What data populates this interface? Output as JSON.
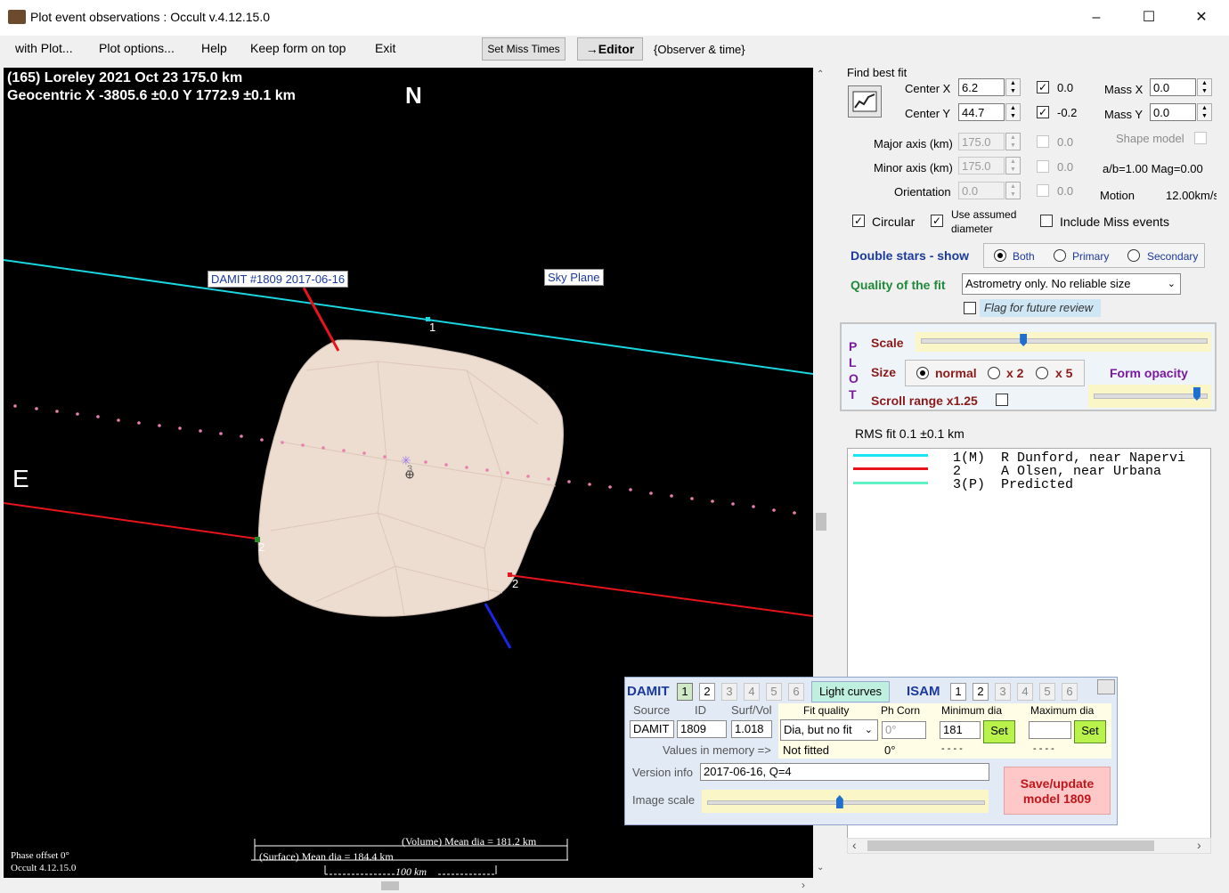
{
  "window": {
    "title": "Plot event observations : Occult v.4.12.15.0",
    "controls": [
      "–",
      "☐",
      "✕"
    ]
  },
  "menu": {
    "items": [
      "with Plot...",
      "Plot options...",
      "Help",
      "Keep form on top",
      "Exit"
    ],
    "set_miss_times": "Set Miss Times",
    "editor": "→Editor",
    "observer_time": "{Observer & time}"
  },
  "plot": {
    "header_line1": "(165) Loreley  2021 Oct 23   175.0 km",
    "header_line2": "Geocentric  X  -3805.6 ±0.0  Y 1772.9 ±0.1 km",
    "north": "N",
    "east": "E",
    "damit_label": "DAMIT #1809 2017-06-16",
    "sky_plane": "Sky Plane",
    "chord_label_1": "1",
    "chord_label_2a": "2",
    "chord_label_2b": "2",
    "center_mark": "3",
    "volume_dia": "(Volume) Mean dia = 181.2 km",
    "surface_dia": "(Surface) Mean dia = 184.4 km",
    "scale_100": "100 km",
    "phase_offset": "Phase offset 0°",
    "occult_version": "Occult 4.12.15.0",
    "colors": {
      "chord1": "#19d6e0",
      "chord2": "#e8141b",
      "body": "#eddcd0"
    }
  },
  "fit": {
    "find_best_fit": "Find best fit",
    "center_x_label": "Center X",
    "center_x": "6.2",
    "center_y_label": "Center Y",
    "center_y": "44.7",
    "cx_offset": "0.0",
    "cy_offset": "-0.2",
    "mass_x_label": "Mass X",
    "mass_x": "0.0",
    "mass_y_label": "Mass Y",
    "mass_y": "0.0",
    "major_label": "Major axis (km)",
    "major": "175.0",
    "major_off": "0.0",
    "minor_label": "Minor axis (km)",
    "minor": "175.0",
    "minor_off": "0.0",
    "orientation_label": "Orientation",
    "orientation": "0.0",
    "orientation_off": "0.0",
    "shape_model": "Shape model",
    "ab_mag": "a/b=1.00  Mag=0.00",
    "motion_label": "Motion",
    "motion": "12.00km/s",
    "circular": "Circular",
    "use_assumed_1": "Use assumed",
    "use_assumed_2": "diameter",
    "include_miss": "Include Miss events",
    "double_stars": "Double stars - show",
    "both": "Both",
    "primary": "Primary",
    "secondary": "Secondary",
    "quality_label": "Quality of the fit",
    "quality_value": "Astrometry only. No reliable size",
    "flag_review": "Flag for future review"
  },
  "plotopts": {
    "p": "P",
    "l": "L",
    "o": "O",
    "t": "T",
    "scale": "Scale",
    "size": "Size",
    "normal": "normal",
    "x2": "x 2",
    "x5": "x 5",
    "form_opacity": "Form opacity",
    "scroll_range": "Scroll range x1.25",
    "scale_level": 0.36,
    "opacity_level": 0.92
  },
  "rms": "RMS fit 0.1 ±0.1 km",
  "legend": [
    {
      "text": "1(M)  R Dunford, near Napervi",
      "color": "#19e6f0"
    },
    {
      "text": "2     A Olsen, near Urbana",
      "color": "#e8141b"
    },
    {
      "text": "3(P)  Predicted",
      "color": "#5ff0c6"
    }
  ],
  "damit": {
    "title": "DAMIT",
    "tabs": [
      "1",
      "2",
      "3",
      "4",
      "5",
      "6"
    ],
    "light_curves": "Light curves",
    "isam": "ISAM",
    "isam_tabs": [
      "1",
      "2",
      "3",
      "4",
      "5",
      "6"
    ],
    "source_label": "Source",
    "id_label": "ID",
    "surf_vol_label": "Surf/Vol",
    "source": "DAMIT",
    "id": "1809",
    "surf_vol": "1.018",
    "fit_quality_label": "Fit quality",
    "fit_quality": "Dia, but no fit",
    "not_fitted": "Not fitted",
    "ph_corr_label": "Ph Corn",
    "ph_corr": "0°",
    "ph_corr_mem": "0°",
    "min_dia_label": "Minimum dia",
    "min_dia": "181",
    "min_dia_mem": "- - - -",
    "max_dia_label": "Maximum dia",
    "max_dia": "",
    "max_dia_mem": "- - - -",
    "set": "Set",
    "values_in_memory": "Values in memory =>",
    "version_label": "Version info",
    "version": "2017-06-16, Q=4",
    "image_scale_label": "Image scale",
    "image_scale_level": 0.48,
    "save_update": "Save/update",
    "model": "model  1809"
  }
}
